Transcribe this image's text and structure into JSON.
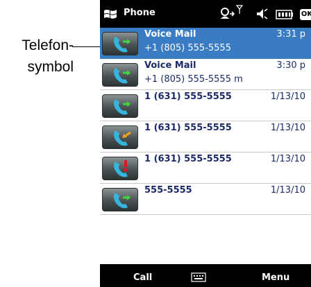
{
  "annotation": {
    "line1": "Telefon-",
    "line2": "symbol"
  },
  "statusbar": {
    "title": "Phone",
    "icons": [
      "windows-logo-icon",
      "connectivity-icon",
      "signal-icon",
      "speaker-icon",
      "battery-icon"
    ],
    "ok_label": "OK"
  },
  "calls": [
    {
      "name": "Voice Mail",
      "number": "+1 (805) 555-5555",
      "time": "3:31 p",
      "type": "outgoing",
      "selected": true
    },
    {
      "name": "Voice Mail",
      "number": "+1 (805) 555-5555 m",
      "time": "3:30 p",
      "type": "outgoing",
      "selected": false
    },
    {
      "name": "1 (631) 555-5555",
      "number": "",
      "time": "1/13/10",
      "type": "outgoing",
      "selected": false
    },
    {
      "name": "1 (631) 555-5555",
      "number": "",
      "time": "1/13/10",
      "type": "incoming",
      "selected": false
    },
    {
      "name": "1 (631) 555-5555",
      "number": "",
      "time": "1/13/10",
      "type": "missed",
      "selected": false
    },
    {
      "name": "555-5555",
      "number": "",
      "time": "1/13/10",
      "type": "outgoing",
      "selected": false
    }
  ],
  "menubar": {
    "left_label": "Call",
    "right_label": "Menu",
    "center_icon": "keyboard-icon"
  },
  "colors": {
    "selected_row": "#3a7cc3",
    "text": "#1a2a68",
    "bar": "#000000",
    "handset": "#35b4de",
    "arrow_outgoing": "#3dd63d",
    "arrow_incoming": "#f0a11a",
    "missed": "#e01818"
  }
}
